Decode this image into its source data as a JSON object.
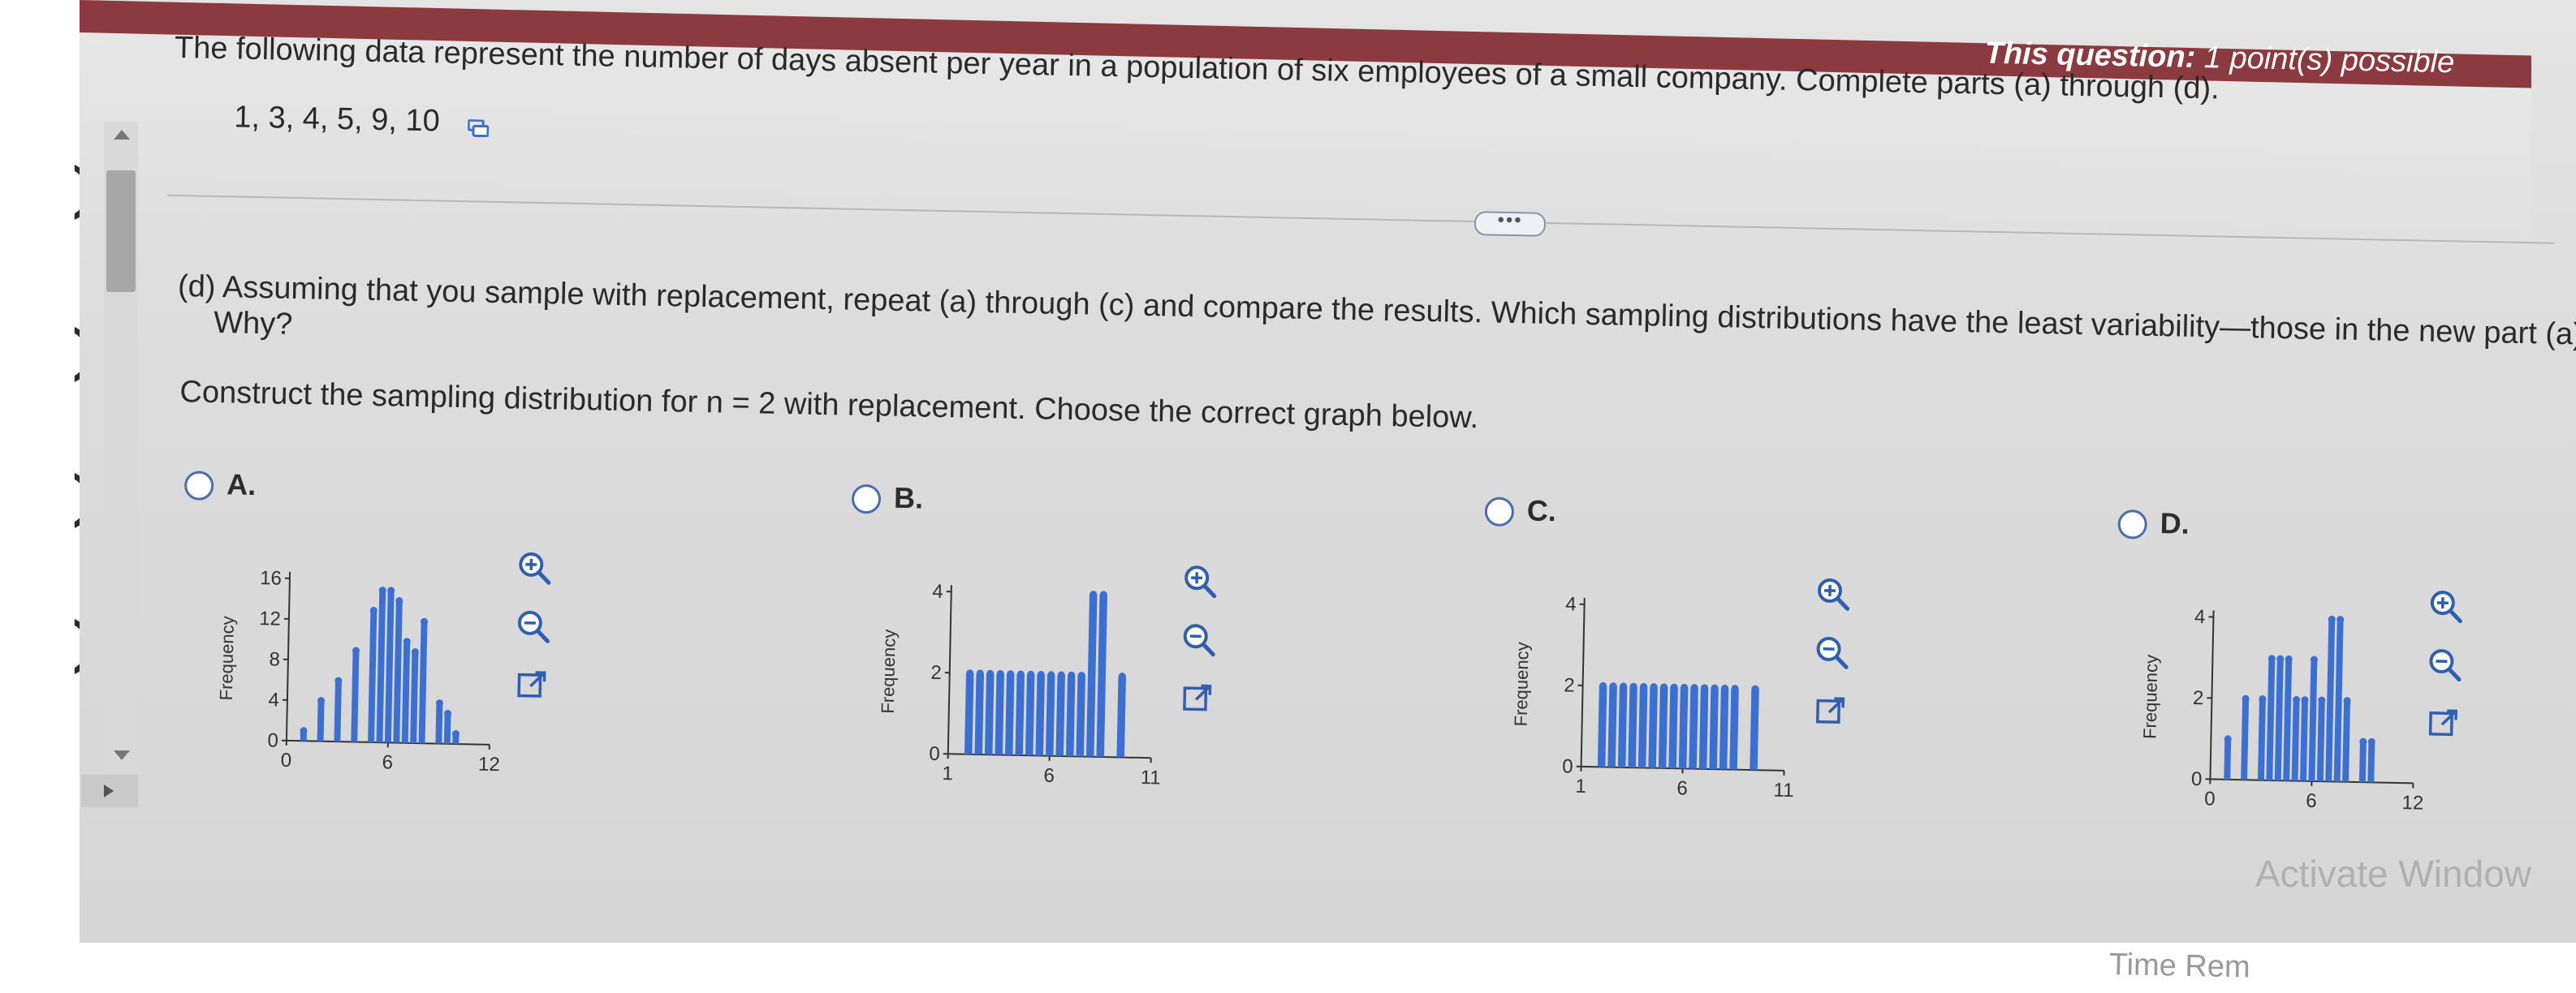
{
  "header": {
    "points_label": "This question:",
    "points_value": "1 point(s) possible"
  },
  "question": {
    "intro": "The following data represent the number of days absent per year in a population of six employees of a small company. Complete parts (a) through (d).",
    "dataset": "1, 3, 4, 5, 9, 10",
    "more_button": "•••",
    "part_d_line1": "(d) Assuming that you sample with replacement, repeat (a) through (c) and compare the results. Which sampling distributions have the least variability—those in the new part (a) or th",
    "part_d_line2": "Why?",
    "construct": "Construct the sampling distribution for n = 2 with replacement. Choose the correct graph below."
  },
  "options": [
    {
      "label": "A.",
      "ylabel": "Frequency",
      "yticks": [
        "0",
        "4",
        "8",
        "12",
        "16"
      ],
      "xticks": [
        "0",
        "6",
        "12"
      ]
    },
    {
      "label": "B.",
      "ylabel": "Frequency",
      "yticks": [
        "0",
        "2",
        "4"
      ],
      "xticks": [
        "1",
        "6",
        "11"
      ]
    },
    {
      "label": "C.",
      "ylabel": "Frequency",
      "yticks": [
        "0",
        "2",
        "4"
      ],
      "xticks": [
        "1",
        "6",
        "11"
      ]
    },
    {
      "label": "D.",
      "ylabel": "Frequency",
      "yticks": [
        "0",
        "2",
        "4"
      ],
      "xticks": [
        "0",
        "6",
        "12"
      ]
    }
  ],
  "chart_data": [
    {
      "type": "bar",
      "name": "Option A",
      "x": [
        1,
        2,
        3,
        4,
        5,
        5.5,
        6,
        6.5,
        7,
        7.5,
        8,
        9,
        9.5,
        10
      ],
      "values": [
        1,
        4,
        6,
        9,
        13,
        15,
        15,
        14,
        10,
        9,
        12,
        4,
        3,
        1
      ],
      "ylim": [
        0,
        16
      ],
      "xlim": [
        0,
        12
      ]
    },
    {
      "type": "bar",
      "name": "Option B",
      "x": [
        2,
        2.5,
        3,
        3.5,
        4,
        4.5,
        5,
        5.5,
        6,
        6.5,
        7,
        7.5,
        8,
        8.5,
        9.5
      ],
      "values": [
        2,
        2,
        2,
        2,
        2,
        2,
        2,
        2,
        2,
        2,
        2,
        2,
        4,
        4,
        2
      ],
      "ylim": [
        0,
        4
      ],
      "xlim": [
        1,
        11
      ]
    },
    {
      "type": "bar",
      "name": "Option C",
      "x": [
        2,
        2.5,
        3,
        3.5,
        4,
        4.5,
        5,
        5.5,
        6,
        6.5,
        7,
        7.5,
        8,
        8.5,
        9.5
      ],
      "values": [
        2,
        2,
        2,
        2,
        2,
        2,
        2,
        2,
        2,
        2,
        2,
        2,
        2,
        2,
        2
      ],
      "ylim": [
        0,
        4
      ],
      "xlim": [
        1,
        11
      ]
    },
    {
      "type": "bar",
      "name": "Option D",
      "x": [
        1,
        2,
        3,
        3.5,
        4,
        4.5,
        5,
        5.5,
        6,
        6.5,
        7,
        7.5,
        8,
        9,
        9.5
      ],
      "values": [
        1,
        2,
        2,
        3,
        3,
        3,
        2,
        2,
        3,
        2,
        4,
        4,
        2,
        1,
        1
      ],
      "ylim": [
        0,
        4
      ],
      "xlim": [
        0,
        12
      ]
    }
  ],
  "watermark": "Activate Window",
  "timer": "Time Rem",
  "colors": {
    "bar": "#3b6fd1",
    "header": "#8b3b3f",
    "radio": "#4b6cb0"
  },
  "icons": [
    "zoom-in-icon",
    "zoom-out-icon",
    "external-link-icon",
    "copy-icon"
  ]
}
